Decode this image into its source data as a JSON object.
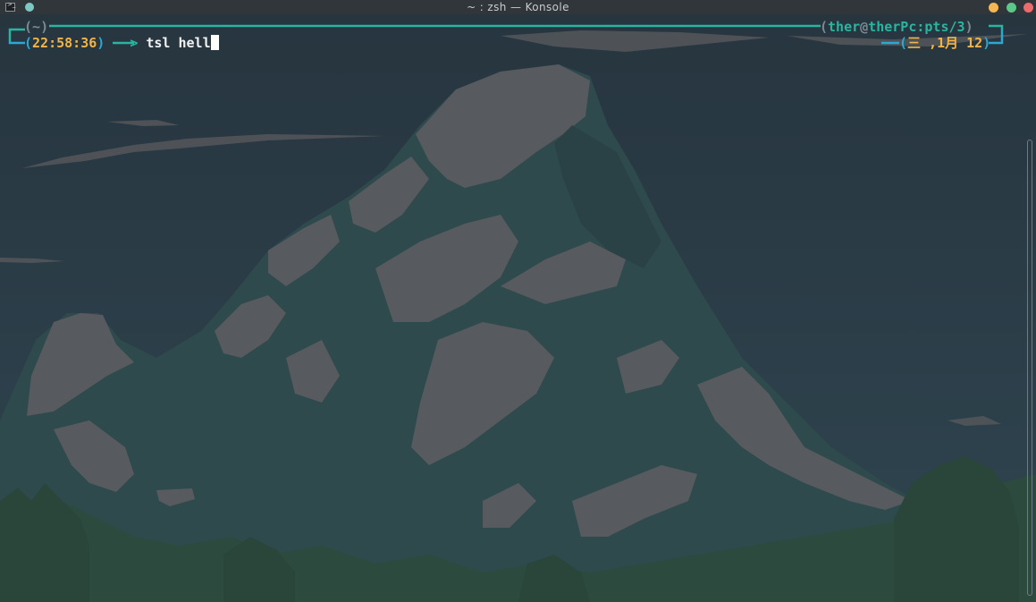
{
  "window": {
    "title": "~ : zsh — Konsole",
    "app_icon": "terminal-icon",
    "buttons": [
      "minimize-button",
      "maximize-button",
      "close-button"
    ]
  },
  "prompt": {
    "line1": {
      "open": "(",
      "cwd": "~",
      "close": ")",
      "user": "ther",
      "at": "@",
      "host": "therPc",
      "tty": ":pts/3"
    },
    "line2": {
      "time": "22:58:36",
      "arrow": ">",
      "command": "tsl hell",
      "date": "三 ,1月 12"
    }
  },
  "colors": {
    "accent_teal": "#2bb4a0",
    "accent_cyan": "#29a9d3",
    "accent_orange": "#f0b44a",
    "background": "#2b3a44"
  }
}
